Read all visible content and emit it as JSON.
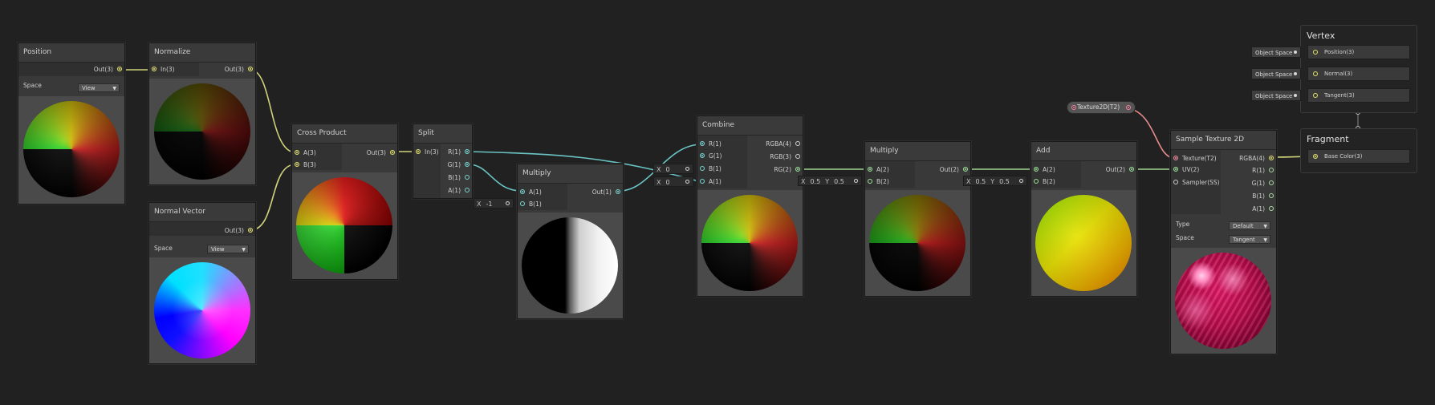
{
  "nodes": {
    "position": {
      "title": "Position",
      "out": "Out(3)",
      "space_label": "Space",
      "space_value": "View"
    },
    "normalize": {
      "title": "Normalize",
      "in": "In(3)",
      "out": "Out(3)"
    },
    "normal_vector": {
      "title": "Normal Vector",
      "out": "Out(3)",
      "space_label": "Space",
      "space_value": "View"
    },
    "cross_product": {
      "title": "Cross Product",
      "in_a": "A(3)",
      "in_b": "B(3)",
      "out": "Out(3)"
    },
    "split": {
      "title": "Split",
      "in": "In(3)",
      "out_r": "R(1)",
      "out_g": "G(1)",
      "out_b": "B(1)",
      "out_a": "A(1)"
    },
    "multiply1": {
      "title": "Multiply",
      "in_a": "A(1)",
      "in_b": "B(1)",
      "out": "Out(1)",
      "b_x_label": "X",
      "b_x_value": "-1"
    },
    "combine": {
      "title": "Combine",
      "in_r": "R(1)",
      "in_g": "G(1)",
      "in_b": "B(1)",
      "in_a": "A(1)",
      "out_rgba": "RGBA(4)",
      "out_rgb": "RGB(3)",
      "out_rg": "RG(2)",
      "b_label": "X",
      "b_value": "0",
      "a_label": "X",
      "a_value": "0"
    },
    "multiply2": {
      "title": "Multiply",
      "in_a": "A(2)",
      "in_b": "B(2)",
      "out": "Out(2)",
      "bx_label": "X",
      "bx_value": "0.5",
      "by_label": "Y",
      "by_value": "0.5"
    },
    "add": {
      "title": "Add",
      "in_a": "A(2)",
      "in_b": "B(2)",
      "out": "Out(2)",
      "bx_label": "X",
      "bx_value": "0.5",
      "by_label": "Y",
      "by_value": "0.5"
    },
    "sample_texture": {
      "title": "Sample Texture 2D",
      "in_tex": "Texture(T2)",
      "in_uv": "UV(2)",
      "in_sampler": "Sampler(SS)",
      "out_rgba": "RGBA(4)",
      "out_r": "R(1)",
      "out_g": "G(1)",
      "out_b": "B(1)",
      "out_a": "A(1)",
      "type_label": "Type",
      "type_value": "Default",
      "space_label": "Space",
      "space_value": "Tangent"
    },
    "texture_property": {
      "label": "Texture2D(T2)"
    }
  },
  "vertex": {
    "title": "Vertex",
    "slots": [
      "Position(3)",
      "Normal(3)",
      "Tangent(3)"
    ],
    "chips": [
      "Object Space",
      "Object Space",
      "Object Space"
    ]
  },
  "fragment": {
    "title": "Fragment",
    "slots": [
      "Base Color(3)"
    ]
  },
  "colors": {
    "background": "#212121",
    "wire_yellow": "#cfd27a",
    "wire_green": "#9fd38f",
    "wire_cyan": "#6bc4c4",
    "wire_pink": "#e88a8a"
  }
}
